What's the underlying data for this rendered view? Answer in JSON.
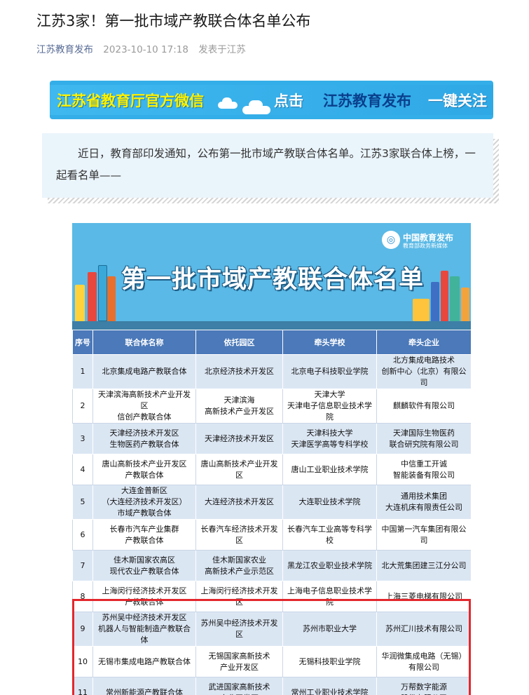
{
  "article": {
    "title": "江苏3家！第一批市域产教联合体名单公布",
    "author": "江苏教育发布",
    "date": "2023-10-10 17:18",
    "location": "发表于江苏",
    "intro": "近日，教育部印发通知，公布第一批市域产教联合体名单。江苏3家联合体上榜，一起看名单——"
  },
  "banner": {
    "part1": "江苏省教育厅官方微信",
    "part2": "点击",
    "part3": "江苏教育发布",
    "part4": "一键关注"
  },
  "infographic": {
    "logo_main": "中国教育发布",
    "logo_sub": "教育部政务新媒体",
    "title": "第一批市域产教联合体名单",
    "columns": [
      "序号",
      "联合体名称",
      "依托园区",
      "牵头学校",
      "牵头企业"
    ],
    "rows": [
      {
        "no": "1",
        "name": "北京集成电路产教联合体",
        "park": "北京经济技术开发区",
        "school": "北京电子科技职业学院",
        "company": "北方集成电路技术\n创新中心（北京）有限公司"
      },
      {
        "no": "2",
        "name": "天津滨海高新技术产业开发区\n信创产教联合体",
        "park": "天津滨海\n高新技术产业开发区",
        "school": "天津大学\n天津电子信息职业技术学院",
        "company": "麒麟软件有限公司"
      },
      {
        "no": "3",
        "name": "天津经济技术开发区\n生物医药产教联合体",
        "park": "天津经济技术开发区",
        "school": "天津科技大学\n天津医学高等专科学校",
        "company": "天津国际生物医药\n联合研究院有限公司"
      },
      {
        "no": "4",
        "name": "唐山高新技术产业开发区\n产教联合体",
        "park": "唐山高新技术产业开发区",
        "school": "唐山工业职业技术学院",
        "company": "中信重工开诚\n智能装备有限公司"
      },
      {
        "no": "5",
        "name": "大连金普新区\n（大连经济技术开发区）\n市域产教联合体",
        "park": "大连经济技术开发区",
        "school": "大连职业技术学院",
        "company": "通用技术集团\n大连机床有限责任公司"
      },
      {
        "no": "6",
        "name": "长春市汽车产业集群\n产教联合体",
        "park": "长春汽车经济技术开发区",
        "school": "长春汽车工业高等专科学校",
        "company": "中国第一汽车集团有限公司"
      },
      {
        "no": "7",
        "name": "佳木斯国家农高区\n现代农业产教联合体",
        "park": "佳木斯国家农业\n高新技术产业示范区",
        "school": "黑龙江农业职业技术学院",
        "company": "北大荒集团建三江分公司"
      },
      {
        "no": "8",
        "name": "上海闵行经济技术开发区\n产教联合体",
        "park": "上海闵行经济技术开发区",
        "school": "上海电子信息职业技术学院",
        "company": "上海三菱电梯有限公司"
      },
      {
        "no": "9",
        "name": "苏州吴中经济技术开发区\n机器人与智能制造产教联合体",
        "park": "苏州吴中经济技术开发区",
        "school": "苏州市职业大学",
        "company": "苏州汇川技术有限公司"
      },
      {
        "no": "10",
        "name": "无锡市集成电路产教联合体",
        "park": "无锡国家高新技术\n产业开发区",
        "school": "无锡科技职业学院",
        "company": "华润微集成电路（无锡）\n有限公司"
      },
      {
        "no": "11",
        "name": "常州新能源产教联合体",
        "park": "武进国家高新技术\n产业开发区",
        "school": "常州工业职业技术学院",
        "company": "万帮数字能源\n股份有限公司"
      }
    ]
  }
}
